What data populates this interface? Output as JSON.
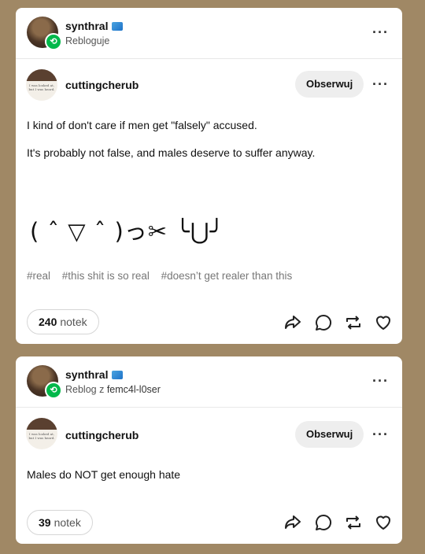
{
  "posts": [
    {
      "reblogger": {
        "name": "synthral",
        "action": "Rebloguje",
        "source": ""
      },
      "author": {
        "name": "cuttingcherub",
        "follow_label": "Obserwuj"
      },
      "body": [
        "I kind of don't care if men get \"falsely\" accused.",
        "It's probably not false, and males deserve to suffer anyway."
      ],
      "kaomoji": "( ˆ ▽ ˆ )っ✂ ╰⋃╯",
      "tags": [
        "#real",
        "#this shit is so real",
        "#doesn’t get realer than this"
      ],
      "notes": {
        "count": "240",
        "label": "notek"
      }
    },
    {
      "reblogger": {
        "name": "synthral",
        "action": "Reblog z",
        "source": "femc4l-l0ser"
      },
      "author": {
        "name": "cuttingcherub",
        "follow_label": "Obserwuj"
      },
      "body": [
        "Males do NOT get enough hate"
      ],
      "notes": {
        "count": "39",
        "label": "notek"
      }
    }
  ],
  "icons": [
    "verified-badge-icon",
    "reblog-badge-icon",
    "more-options-icon",
    "share-icon",
    "reply-icon",
    "reblog-icon",
    "like-icon"
  ],
  "colors": {
    "background": "#a08865",
    "reblog_green": "#00b84a",
    "card": "#ffffff"
  }
}
